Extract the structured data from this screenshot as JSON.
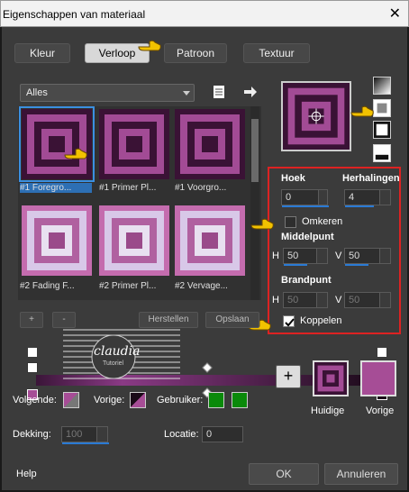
{
  "window": {
    "title": "Eigenschappen van materiaal",
    "close": "✕"
  },
  "tabs": [
    {
      "label": "Kleur",
      "active": false
    },
    {
      "label": "Verloop",
      "active": true
    },
    {
      "label": "Patroon",
      "active": false
    },
    {
      "label": "Textuur",
      "active": false
    }
  ],
  "library": {
    "category": "Alles"
  },
  "thumbnails": [
    {
      "label": "#1 Foregro...",
      "selected": true
    },
    {
      "label": "#1 Primer Pl...",
      "selected": false
    },
    {
      "label": "#1 Voorgro...",
      "selected": false
    },
    {
      "label": "#2 Fading F...",
      "selected": false
    },
    {
      "label": "#2 Primer Pl...",
      "selected": false
    },
    {
      "label": "#2 Vervage...",
      "selected": false
    }
  ],
  "settings": {
    "hoek_label": "Hoek",
    "hoek_value": "0",
    "herhalingen_label": "Herhalingen",
    "herhalingen_value": "4",
    "omkeren_label": "Omkeren",
    "omkeren_checked": false,
    "middelpunt_label": "Middelpunt",
    "h_label": "H",
    "v_label": "V",
    "middelpunt_h": "50",
    "middelpunt_v": "50",
    "brandpunt_label": "Brandpunt",
    "brandpunt_h": "50",
    "brandpunt_v": "50",
    "koppelen_label": "Koppelen",
    "koppelen_checked": true
  },
  "gradient_actions": {
    "add": "+",
    "remove": "-",
    "herstellen": "Herstellen",
    "opslaan": "Opslaan"
  },
  "watermark": {
    "text": "claudia",
    "subtext": "Tutoriel"
  },
  "stops": {
    "volgende_label": "Volgende:",
    "vorige_label": "Vorige:",
    "gebruiker_label": "Gebruiker:",
    "dekking_label": "Dekking:",
    "dekking_value": "100",
    "locatie_label": "Locatie:",
    "locatie_value": "0"
  },
  "preview": {
    "add": "+",
    "huidige_label": "Huidige",
    "vorige_label": "Vorige"
  },
  "footer": {
    "help": "Help",
    "ok": "OK",
    "cancel": "Annuleren"
  },
  "colors": {
    "accent_blue": "#2a7ad4",
    "highlight_red": "#dd2222",
    "gradient_purple": "#8a3a85",
    "gradient_dark": "#1a0a18",
    "swatch_pink": "#a64d96",
    "swatch_green": "#0a8a0a",
    "pointer_yellow": "#f2c200"
  },
  "icons": {
    "new_doc": "document-icon",
    "arrow": "arrow-right-icon",
    "pointer": "pointing-hand-icon"
  }
}
